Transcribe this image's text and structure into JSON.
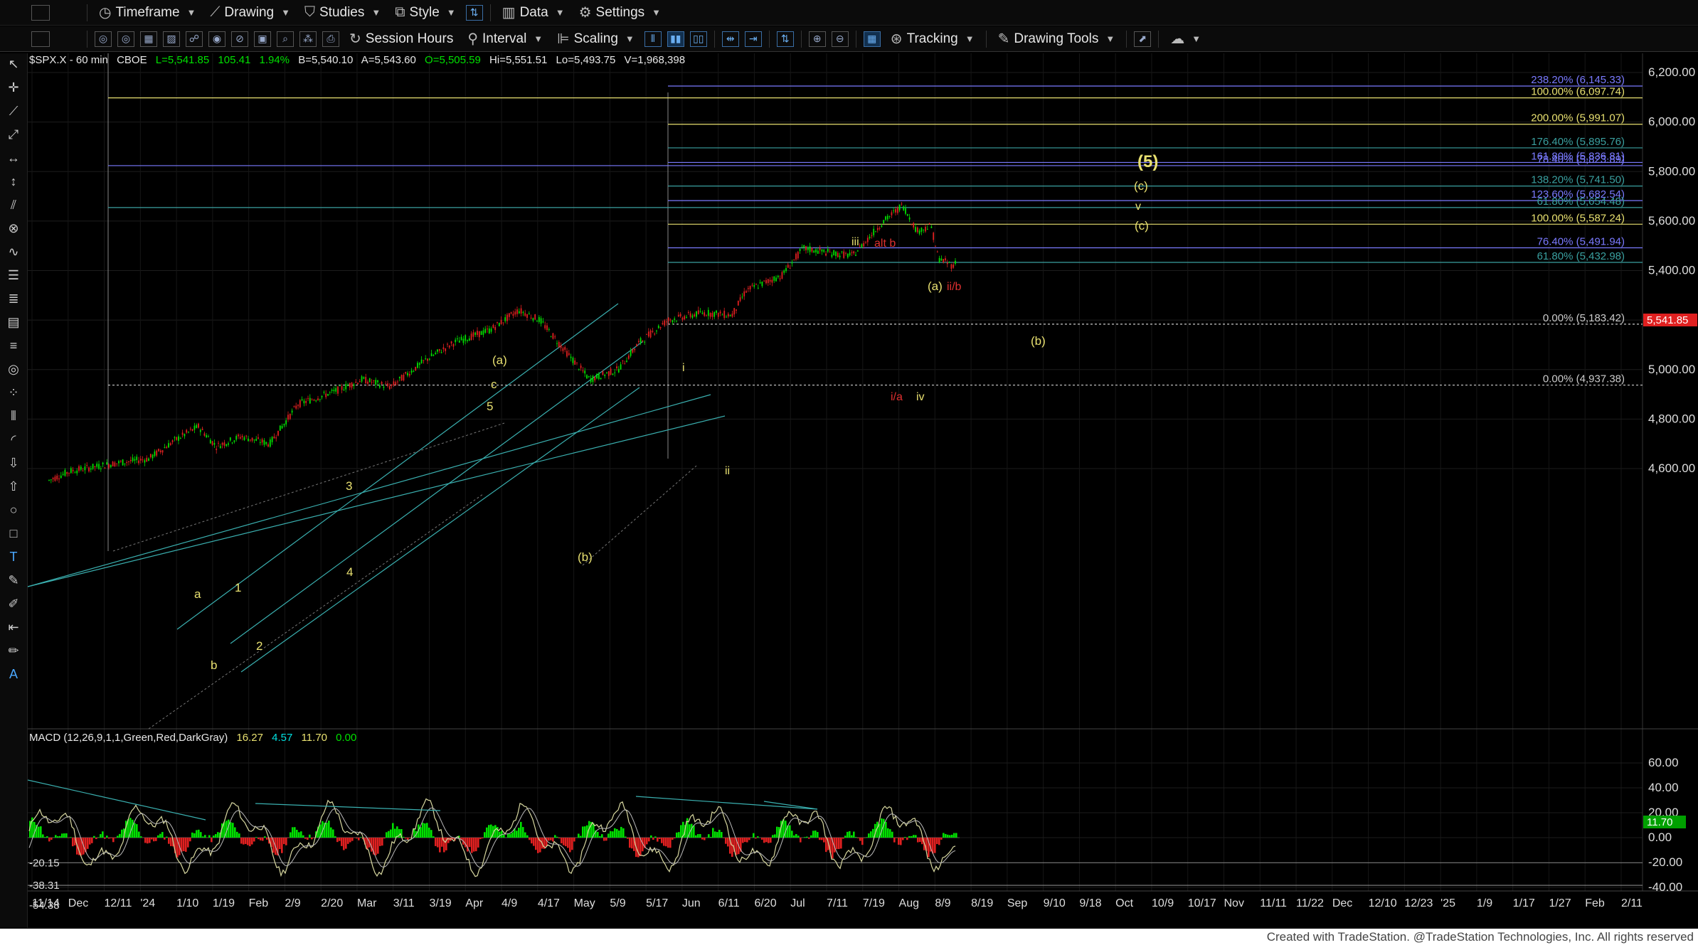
{
  "toolbar1": {
    "items": [
      {
        "label": "Timeframe",
        "icon": "clock-icon"
      },
      {
        "label": "Drawing",
        "icon": "drawing-icon"
      },
      {
        "label": "Studies",
        "icon": "studies-icon"
      },
      {
        "label": "Style",
        "icon": "style-icon"
      },
      {
        "label": "Data",
        "icon": "data-icon"
      },
      {
        "label": "Settings",
        "icon": "gear-icon"
      }
    ]
  },
  "toolbar2": {
    "items": [
      {
        "label": "Session Hours",
        "icon": "session-hours-icon"
      },
      {
        "label": "Interval",
        "icon": "interval-icon"
      },
      {
        "label": "Scaling",
        "icon": "scaling-icon"
      },
      {
        "label": "Tracking",
        "icon": "tracking-icon"
      },
      {
        "label": "Drawing Tools",
        "icon": "drawing-tools-icon"
      }
    ]
  },
  "header_line": {
    "symbol": "$SPX.X - 60 min",
    "exchange": "CBOE",
    "last": "L=5,541.85",
    "change": "105.41",
    "pct": "1.94%",
    "bid": "B=5,540.10",
    "ask": "A=5,543.60",
    "open": "O=5,505.59",
    "high": "Hi=5,551.51",
    "low": "Lo=5,493.75",
    "volume": "V=1,968,398"
  },
  "macd_header": {
    "label": "MACD (12,26,9,1,1,Green,Red,DarkGray)",
    "v1": "16.27",
    "v2": "4.57",
    "v3": "11.70",
    "v4": "0.00"
  },
  "price_axis": [
    "6,200.00",
    "6,000.00",
    "5,800.00",
    "5,600.00",
    "5,400.00",
    "5,200.00",
    "5,000.00",
    "4,800.00",
    "4,600.00"
  ],
  "price_current": "5,541.85",
  "macd_axis": [
    "60.00",
    "40.00",
    "20.00",
    "0.00",
    "-20.00",
    "-40.00"
  ],
  "macd_current": "11.70",
  "macd_left_levels": [
    "-20.15",
    "-38.31",
    "-54.38"
  ],
  "date_axis": [
    "11/14",
    "Dec",
    "12/11",
    "'24",
    "1/10",
    "1/19",
    "Feb",
    "2/9",
    "2/20",
    "Mar",
    "3/11",
    "3/19",
    "Apr",
    "4/9",
    "4/17",
    "May",
    "5/9",
    "5/17",
    "Jun",
    "6/11",
    "6/20",
    "Jul",
    "7/11",
    "7/19",
    "Aug",
    "8/9",
    "8/19",
    "Sep",
    "9/10",
    "9/18",
    "Oct",
    "10/9",
    "10/17",
    "Nov",
    "11/11",
    "11/22",
    "Dec",
    "12/10",
    "12/23",
    "'25",
    "1/9",
    "1/17",
    "1/27",
    "Feb",
    "2/11"
  ],
  "fib_levels": [
    {
      "label": "238.20% (6,145.33)",
      "color": "#7a7aff"
    },
    {
      "label": "100.00% (6,097.74)",
      "color": "#e8e070"
    },
    {
      "label": "200.00% (5,991.07)",
      "color": "#e8e070"
    },
    {
      "label": "176.40% (5,895.76)",
      "color": "#3aa0a0"
    },
    {
      "label": "161.80% (5,836.81)",
      "color": "#7a7aff"
    },
    {
      "label": "78.40% (5,823.89)",
      "color": "#7a7aff"
    },
    {
      "label": "138.20% (5,741.50)",
      "color": "#3aa0a0"
    },
    {
      "label": "123.60% (5,682.54)",
      "color": "#7a7aff"
    },
    {
      "label": "61.80% (5,654.48)",
      "color": "#3aa0a0"
    },
    {
      "label": "100.00% (5,587.24)",
      "color": "#e8e070"
    },
    {
      "label": "76.40% (5,491.94)",
      "color": "#7a7aff"
    },
    {
      "label": "61.80% (5,432.98)",
      "color": "#3aa0a0"
    },
    {
      "label": "0.00% (5,183.42)",
      "color": "#cccccc"
    },
    {
      "label": "0.00% (4,937.38)",
      "color": "#cccccc"
    }
  ],
  "wave_labels": [
    {
      "text": "(5)",
      "color": "#e8e070"
    },
    {
      "text": "(c)",
      "color": "#e8e070"
    },
    {
      "text": "v",
      "color": "#e8e070"
    },
    {
      "text": "(c)",
      "color": "#e8e070"
    },
    {
      "text": "iii",
      "color": "#e8e070"
    },
    {
      "text": "alt b",
      "color": "#e03030"
    },
    {
      "text": "(a)",
      "color": "#e8e070"
    },
    {
      "text": "ii/b",
      "color": "#e03030"
    },
    {
      "text": "(b)",
      "color": "#e8e070"
    },
    {
      "text": "i/a",
      "color": "#e03030"
    },
    {
      "text": "iv",
      "color": "#e8e070"
    },
    {
      "text": "i",
      "color": "#e8e070"
    },
    {
      "text": "ii",
      "color": "#e8e070"
    },
    {
      "text": "(a)",
      "color": "#e8e070"
    },
    {
      "text": "c",
      "color": "#e8e070"
    },
    {
      "text": "5",
      "color": "#e8e070"
    },
    {
      "text": "3",
      "color": "#e8e070"
    },
    {
      "text": "4",
      "color": "#e8e070"
    },
    {
      "text": "(b)",
      "color": "#e8e070"
    },
    {
      "text": "a",
      "color": "#e8e070"
    },
    {
      "text": "1",
      "color": "#e8e070"
    },
    {
      "text": "2",
      "color": "#e8e070"
    },
    {
      "text": "b",
      "color": "#e8e070"
    }
  ],
  "footer": "Created with TradeStation. @TradeStation Technologies, Inc. All rights reserved",
  "colors": {
    "up": "#00e000",
    "down": "#e02020",
    "macd_line": "#d8d8a0",
    "signal_line": "#bbbbbb",
    "channel": "#3ab0b0",
    "fib_blue": "#7a7aff",
    "fib_yellow": "#e8e070",
    "fib_teal": "#3aa0a0"
  }
}
